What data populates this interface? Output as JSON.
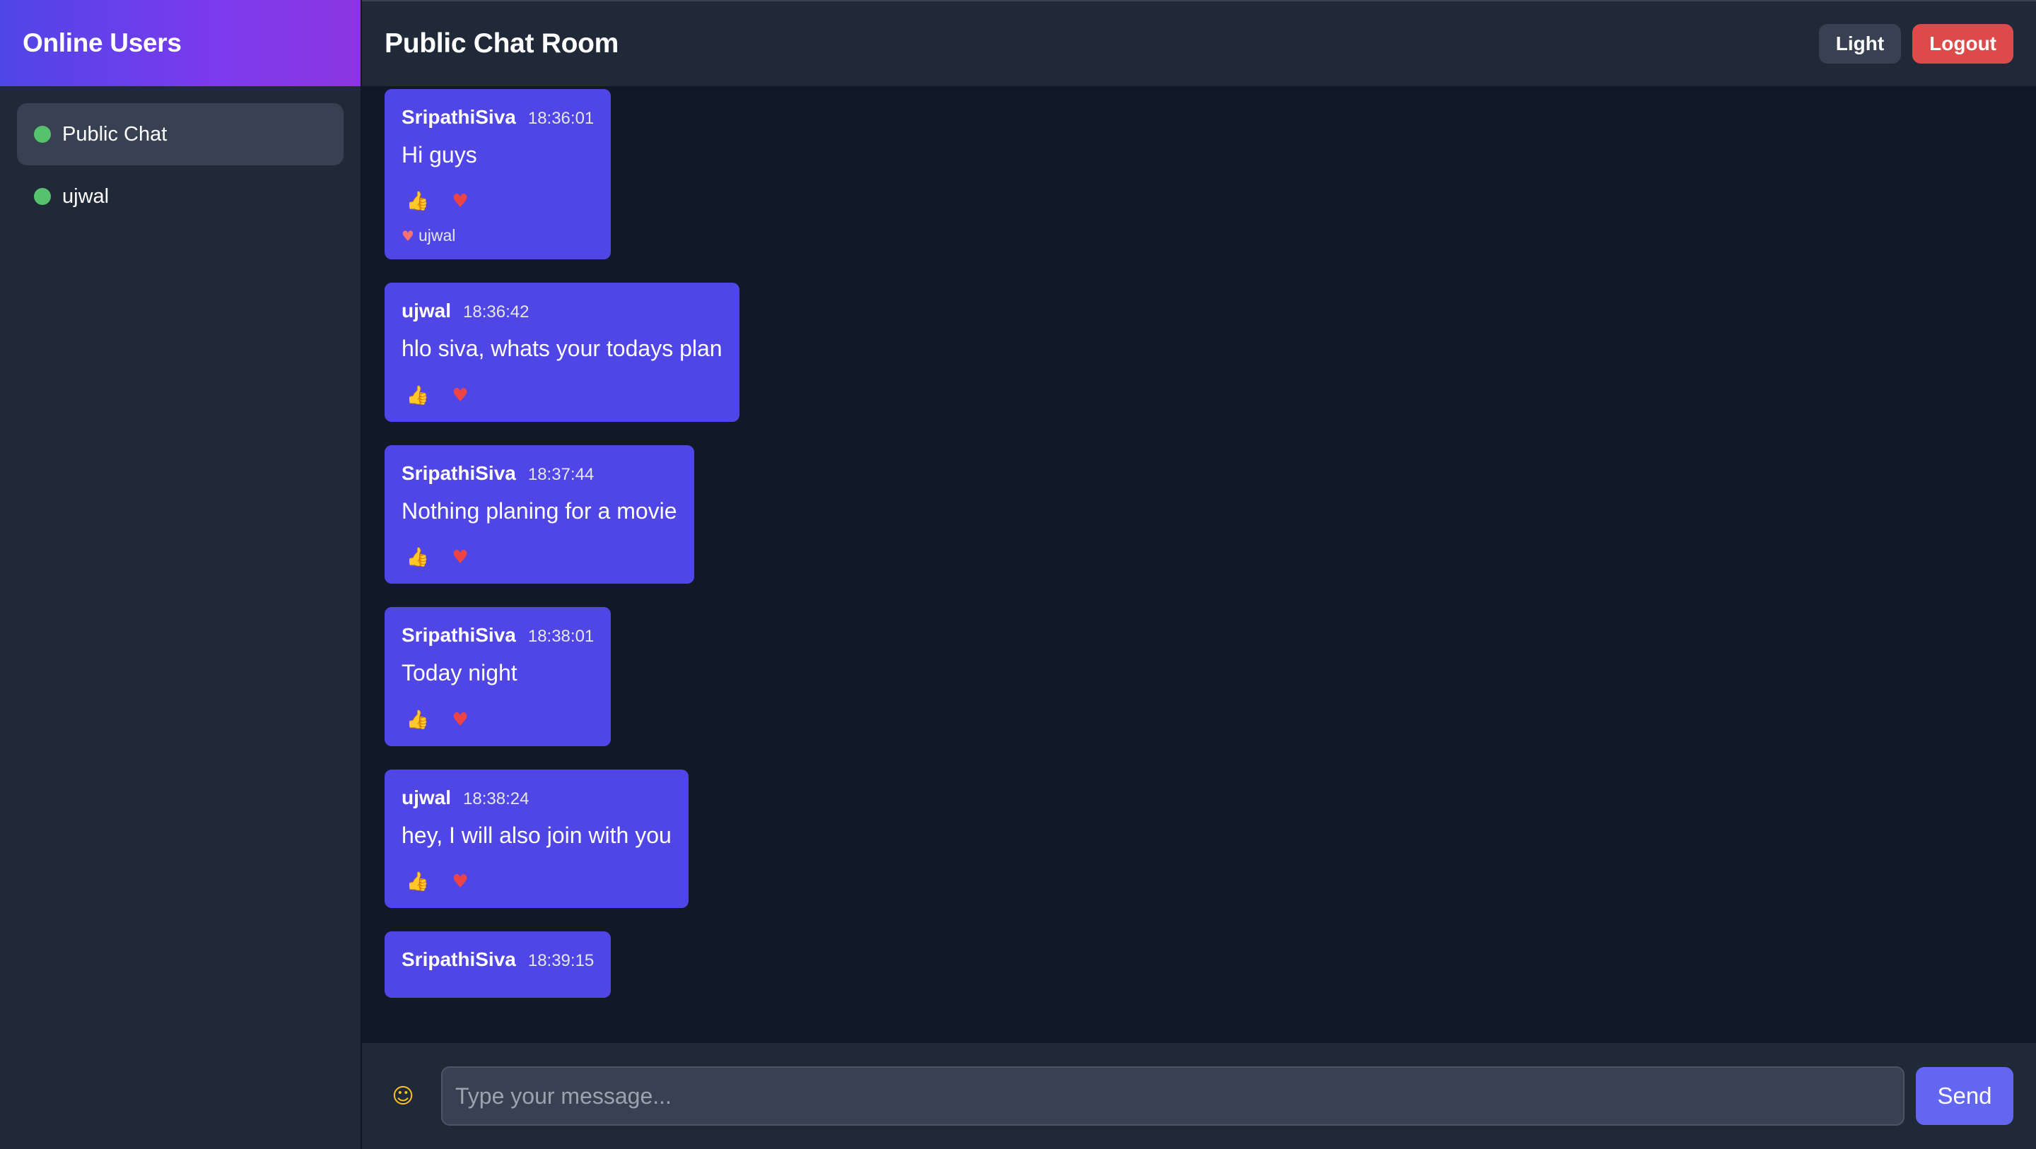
{
  "sidebar": {
    "title": "Online Users",
    "items": [
      {
        "label": "Public Chat",
        "active": true
      },
      {
        "label": "ujwal",
        "active": false
      }
    ]
  },
  "header": {
    "title": "Public Chat Room",
    "theme_button": "Light",
    "logout_button": "Logout"
  },
  "messages": [
    {
      "user": "SripathiSiva",
      "time": "18:36:01",
      "text": "Hi guys",
      "reactions": [
        "thumbs-up",
        "heart"
      ],
      "reacted_by": "ujwal"
    },
    {
      "user": "ujwal",
      "time": "18:36:42",
      "text": "hlo siva, whats your todays plan",
      "reactions": [
        "thumbs-up",
        "heart"
      ]
    },
    {
      "user": "SripathiSiva",
      "time": "18:37:44",
      "text": "Nothing planing for a movie",
      "reactions": [
        "thumbs-up",
        "heart"
      ]
    },
    {
      "user": "SripathiSiva",
      "time": "18:38:01",
      "text": "Today night",
      "reactions": [
        "thumbs-up",
        "heart"
      ]
    },
    {
      "user": "ujwal",
      "time": "18:38:24",
      "text": "hey, I will also join with you",
      "reactions": [
        "thumbs-up",
        "heart"
      ]
    },
    {
      "user": "SripathiSiva",
      "time": "18:39:15",
      "text": "",
      "reactions": []
    }
  ],
  "composer": {
    "placeholder": "Type your message...",
    "value": "",
    "send_label": "Send"
  },
  "colors": {
    "accent": "#4f46e5",
    "online": "#56c26d",
    "logout": "#dc4a4a",
    "background": "#111827",
    "panel": "#1f2937"
  }
}
